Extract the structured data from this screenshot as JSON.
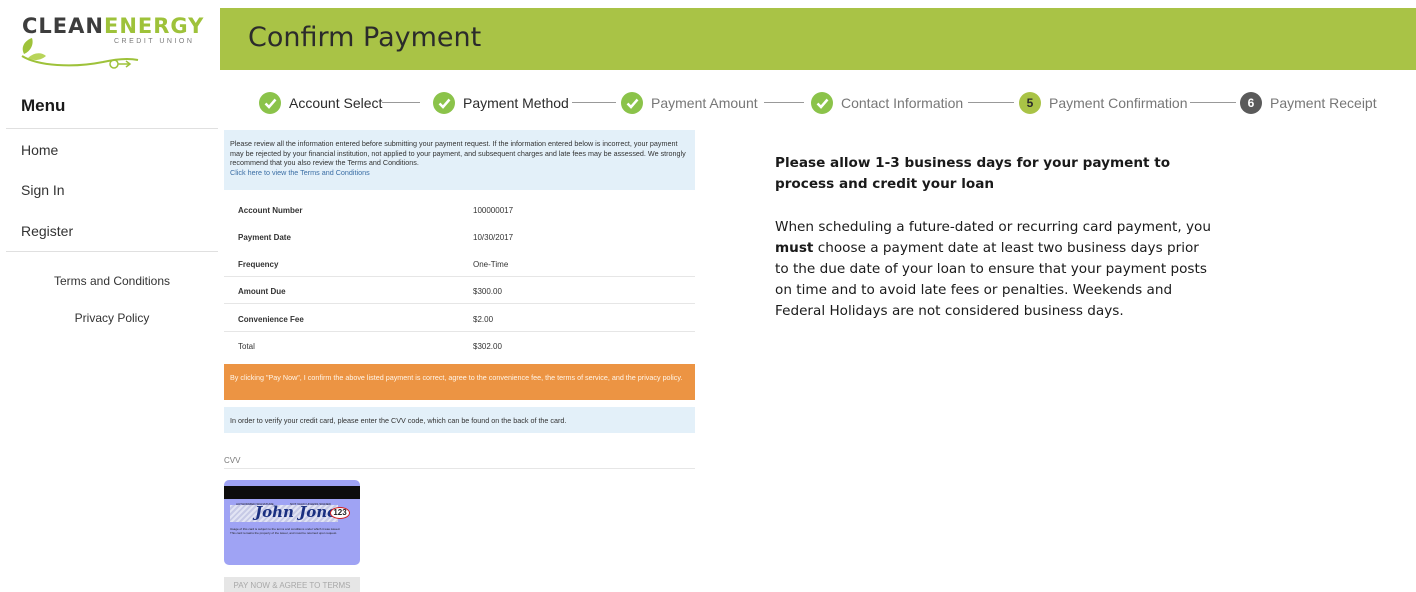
{
  "brand": {
    "name_part1": "CLEAN",
    "name_part2": "ENERGY",
    "subtitle": "CREDIT UNION",
    "accent_color": "#a9c346"
  },
  "header": {
    "title": "Confirm Payment"
  },
  "sidebar": {
    "menu_title": "Menu",
    "items": [
      {
        "label": "Home"
      },
      {
        "label": "Sign In"
      },
      {
        "label": "Register"
      }
    ],
    "links": [
      {
        "label": "Terms and Conditions"
      },
      {
        "label": "Privacy Policy"
      }
    ]
  },
  "stepper": {
    "steps": [
      {
        "label": "Account Select",
        "status": "complete",
        "icon": "check-icon"
      },
      {
        "label": "Payment Method",
        "status": "complete",
        "icon": "check-icon"
      },
      {
        "label": "Payment Amount",
        "status": "complete",
        "icon": "check-icon"
      },
      {
        "label": "Contact Information",
        "status": "complete",
        "icon": "check-icon"
      },
      {
        "label": "Payment Confirmation",
        "status": "current",
        "number": "5"
      },
      {
        "label": "Payment Receipt",
        "status": "upcoming",
        "number": "6"
      }
    ]
  },
  "confirmation": {
    "notice": "Please review all the information entered before submitting your payment request. If the information entered below is incorrect, your payment may be rejected by your financial institution, not applied to your payment, and subsequent charges and late fees may be assessed. We strongly recommend that you also review the Terms and Conditions.",
    "terms_link": "Click here to view the Terms and Conditions",
    "rows": [
      {
        "label": "Account Number",
        "value": "100000017"
      },
      {
        "label": "Payment Date",
        "value": "10/30/2017"
      },
      {
        "label": "Frequency",
        "value": "One-Time"
      },
      {
        "label": "Amount Due",
        "value": "$300.00"
      },
      {
        "label": "Convenience Fee",
        "value": "$2.00"
      },
      {
        "label": "Total",
        "value": "$302.00"
      }
    ],
    "agreement": "By clicking \"Pay Now\", I confirm the above listed payment is correct, agree to the convenience fee, the terms of service, and the privacy policy.",
    "cvv_instructions": "In order to verify your credit card, please enter the CVV code, which can be found on the back of the card.",
    "cvv_label": "CVV",
    "card": {
      "header_left": "AUTHORIZED SIGNATURE",
      "header_right": "NOT VALID UNLESS SIGNED",
      "signature": "John Jones",
      "cvv_example": "123",
      "fine_print_1": "Usage of this card is subject to the terms and conditions under which it was issued.",
      "fine_print_2": "This card remains the property of the issuer, and must be returned upon request."
    },
    "pay_button": "PAY NOW & AGREE TO TERMS"
  },
  "info_panel": {
    "heading": "Please allow 1-3 business days for your payment to process and credit your loan",
    "body_before": "When scheduling a future-dated or recurring card payment, you ",
    "body_bold": "must",
    "body_after": " choose a payment date at least two business days prior to the due date of your loan to ensure that your payment posts on time and to avoid late fees or penalties. Weekends and Federal Holidays are not considered business days."
  }
}
